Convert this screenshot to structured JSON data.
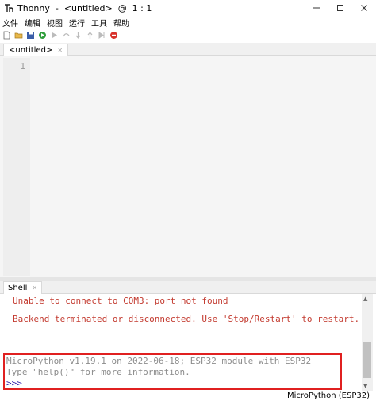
{
  "window": {
    "title": "Thonny  -  <untitled>  @  1 : 1"
  },
  "menu": {
    "items": [
      "文件",
      "编辑",
      "视图",
      "运行",
      "工具",
      "帮助"
    ]
  },
  "editor": {
    "tab_label": "<untitled>",
    "line_numbers": [
      "1"
    ]
  },
  "shell": {
    "tab_label": "Shell",
    "lines": [
      "Unable to connect to COM3: port not found",
      "Backend terminated or disconnected. Use 'Stop/Restart' to restart.",
      "MicroPython v1.19.1 on 2022-06-18; ESP32 module with ESP32",
      "Type \"help()\" for more information.",
      ">>>"
    ]
  },
  "status": {
    "interpreter": "MicroPython (ESP32)"
  },
  "colors": {
    "error_text": "#c33a2f",
    "info_text": "#8c8c8c",
    "prompt": "#2a1aa8",
    "highlight_border": "#e02020"
  },
  "icons": {
    "toolbar": [
      "new-file-icon",
      "open-file-icon",
      "save-icon",
      "run-icon",
      "debug-icon",
      "step-over-icon",
      "step-into-icon",
      "step-out-icon",
      "resume-icon",
      "stop-icon"
    ]
  }
}
